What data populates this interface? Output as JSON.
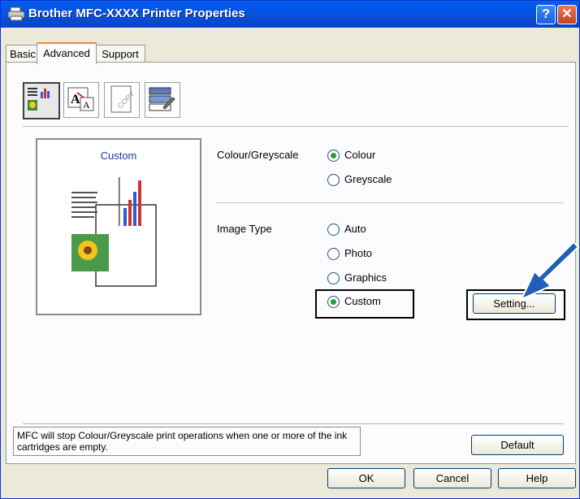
{
  "window": {
    "title": "Brother MFC-XXXX Printer Properties",
    "help_label": "?",
    "close_label": "✕"
  },
  "tabs": [
    {
      "label": "Basic"
    },
    {
      "label": "Advanced"
    },
    {
      "label": "Support"
    }
  ],
  "toolbar_icons": [
    "colour-settings-icon",
    "scaling-icon",
    "watermark-icon",
    "device-options-icon"
  ],
  "preview": {
    "label": "Custom"
  },
  "colour_greyscale": {
    "label": "Colour/Greyscale",
    "options": [
      "Colour",
      "Greyscale"
    ],
    "selected": "Colour"
  },
  "image_type": {
    "label": "Image Type",
    "options": [
      "Auto",
      "Photo",
      "Graphics",
      "Custom"
    ],
    "selected": "Custom"
  },
  "buttons": {
    "setting": "Setting...",
    "default": "Default",
    "ok": "OK",
    "cancel": "Cancel",
    "help": "Help"
  },
  "status_message": "MFC will stop Colour/Greyscale print operations when one or more of the ink cartridges are empty.",
  "colors": {
    "title_bar": "#0058ee",
    "radio_dot": "#2a9a3c",
    "arrow": "#1f5fb5",
    "active_tab_accent": "#e68b2c"
  }
}
